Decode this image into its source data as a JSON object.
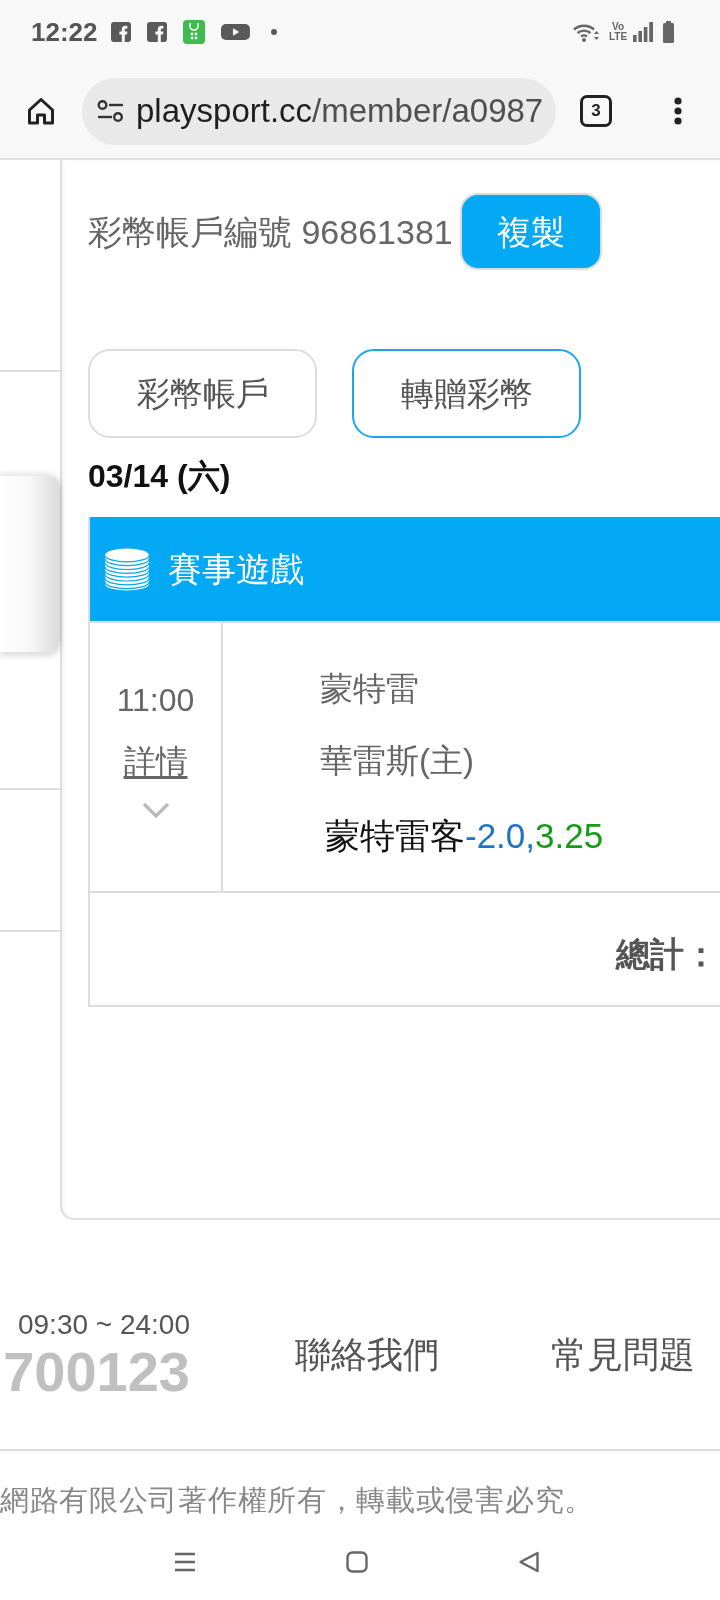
{
  "status_bar": {
    "time": "12:22",
    "network_label": "Vo LTE"
  },
  "browser": {
    "url": {
      "domain": "playsport.cc",
      "path": "/member/a0987"
    },
    "tab_count": "3"
  },
  "sidebar": {
    "items": [
      {
        "selected": false
      },
      {
        "selected": true
      },
      {
        "selected": false
      },
      {
        "selected": false
      }
    ]
  },
  "account": {
    "number_text": "彩幣帳戶編號 96861381",
    "copy_button": "複製"
  },
  "tabs": [
    {
      "label": "彩幣帳戶",
      "selected": false
    },
    {
      "label": "轉贈彩幣",
      "selected": true
    }
  ],
  "date": "03/14 (六)",
  "games": {
    "title": "賽事遊戲",
    "rows": [
      {
        "time": "11:00",
        "details_link": "詳情",
        "expanded": false,
        "away_team": "蒙特雷",
        "home_team": "華雷斯(主)",
        "pick": {
          "team": "蒙特雷客",
          "handicap": "-2.0,",
          "odds": "3.25"
        }
      }
    ],
    "total_label": "總計："
  },
  "footer": {
    "hours": "09:30 ~ 24:00",
    "phone": "700123",
    "links": [
      "聯絡我們",
      "常見問題"
    ],
    "copyright": "網路有限公司著作權所有，轉載或侵害必究。"
  }
}
